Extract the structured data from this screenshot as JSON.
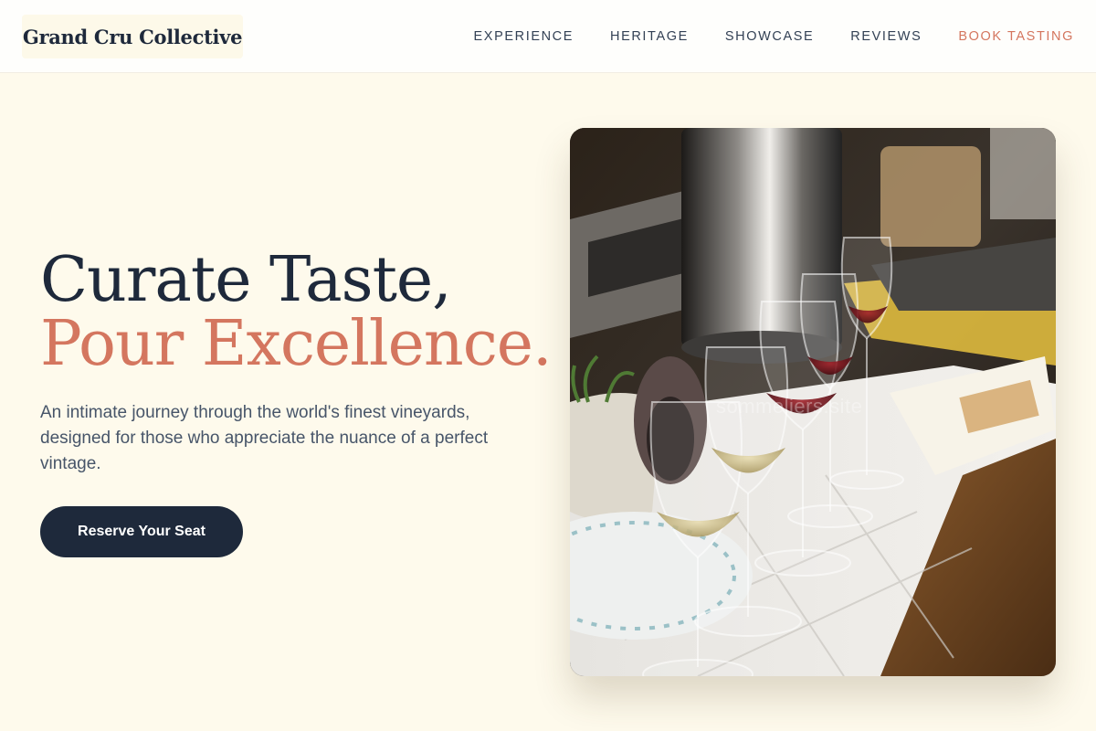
{
  "header": {
    "logo": "Grand Cru Collective",
    "nav": [
      {
        "label": "EXPERIENCE"
      },
      {
        "label": "HERITAGE"
      },
      {
        "label": "SHOWCASE"
      },
      {
        "label": "REVIEWS"
      },
      {
        "label": "BOOK TASTING"
      }
    ]
  },
  "hero": {
    "title_line1": "Curate Taste,",
    "title_line2": "Pour Excellence.",
    "subtitle": "An intimate journey through the world's finest vineyards, designed for those who appreciate the nuance of a perfect vintage.",
    "cta_label": "Reserve Your Seat",
    "image_watermark": "sommeliers.site"
  },
  "colors": {
    "background": "#fefaec",
    "navy": "#1e293b",
    "accent": "#d4765f",
    "body_text": "#475569"
  }
}
